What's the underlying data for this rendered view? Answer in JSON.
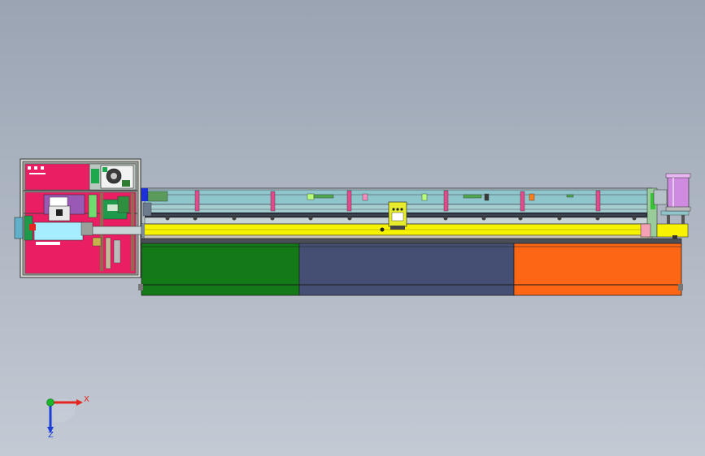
{
  "viewport": {
    "background_top": "#9aa4b3",
    "background_bottom": "#c3cad4"
  },
  "colors": {
    "control_cabinet": "#ea1e63",
    "green_panel": "#137a17",
    "blue_panel": "#454f74",
    "orange_panel": "#fc6614",
    "rail": "#f7f200",
    "frame": "#8fc6cc",
    "cylinder": "#cf8be0"
  },
  "triad": {
    "x_label": "X",
    "z_label": "Z",
    "x_color": "#e3261f",
    "y_color": "#19b52a",
    "z_color": "#1e3fd6"
  }
}
